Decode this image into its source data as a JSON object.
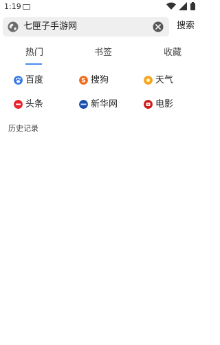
{
  "status_bar": {
    "time": "1:19"
  },
  "search": {
    "query": "七匣子手游网",
    "button_label": "搜索"
  },
  "tabs": [
    {
      "label": "热门",
      "active": true
    },
    {
      "label": "书签",
      "active": false
    },
    {
      "label": "收藏",
      "active": false
    }
  ],
  "shortcuts": [
    {
      "label": "百度",
      "icon": "baidu-icon",
      "color": "#3b78e7"
    },
    {
      "label": "搜狗",
      "icon": "sogou-icon",
      "color": "#f26c1b"
    },
    {
      "label": "天气",
      "icon": "weather-icon",
      "color": "#f5a623"
    },
    {
      "label": "头条",
      "icon": "toutiao-icon",
      "color": "#e8242c"
    },
    {
      "label": "新华网",
      "icon": "xinhua-icon",
      "color": "#1a4fa8"
    },
    {
      "label": "电影",
      "icon": "movie-icon",
      "color": "#d0191b"
    }
  ],
  "history": {
    "title": "历史记录"
  },
  "colors": {
    "accent": "#4a8af4",
    "search_bg": "#efefef"
  }
}
